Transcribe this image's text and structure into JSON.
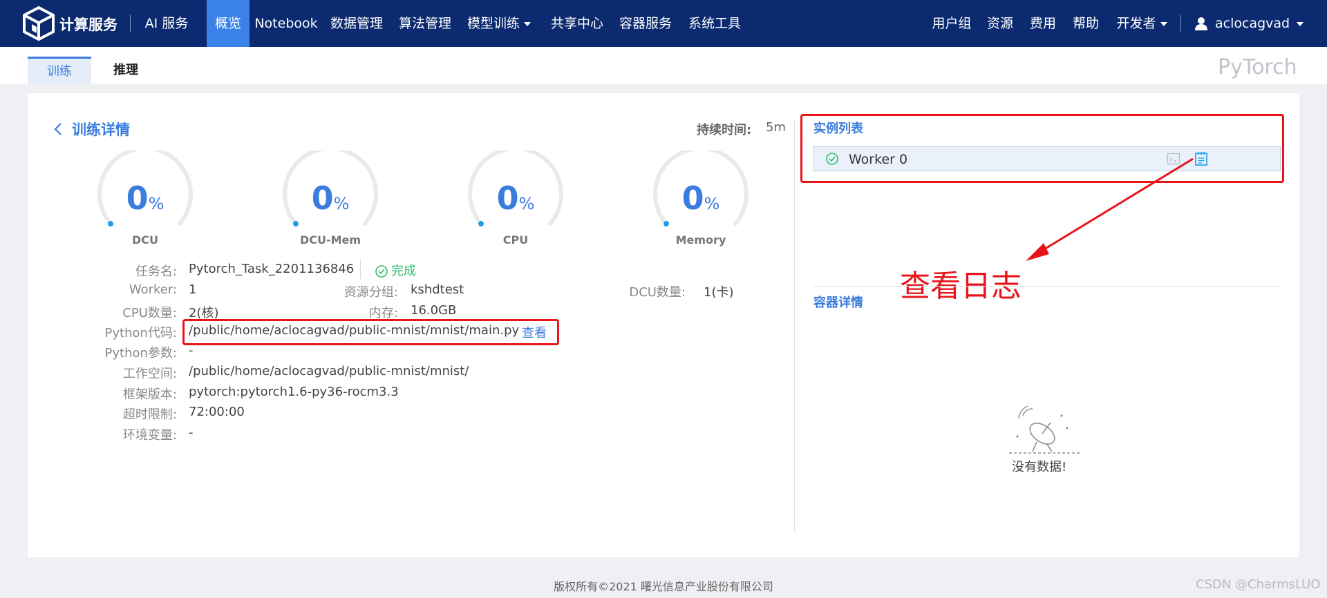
{
  "nav": {
    "brand": "计算服务",
    "ai_service": "AI 服务",
    "items": [
      "概览",
      "Notebook",
      "数据管理",
      "算法管理",
      "模型训练",
      "共享中心",
      "容器服务",
      "系统工具"
    ],
    "right_items": [
      "用户组",
      "资源",
      "费用",
      "帮助",
      "开发者"
    ],
    "username": "aclocagvad",
    "accent_color": "#3b82e8",
    "bar_color": "#0b2a6f"
  },
  "subtabs": [
    "训练",
    "推理"
  ],
  "framework_label": "PyTorch",
  "detail": {
    "back_label": "训练详情",
    "duration_label": "持续时间:",
    "duration_value": "5m",
    "gauges": [
      {
        "label": "DCU",
        "value": "0",
        "unit": "%"
      },
      {
        "label": "DCU-Mem",
        "value": "0",
        "unit": "%"
      },
      {
        "label": "CPU",
        "value": "0",
        "unit": "%"
      },
      {
        "label": "Memory",
        "value": "0",
        "unit": "%"
      }
    ],
    "task_name_label": "任务名:",
    "task_name": "Pytorch_Task_2201136846",
    "status": "完成",
    "worker_label": "Worker:",
    "worker_value": "1",
    "resource_group_label": "资源分组:",
    "resource_group_value": "kshdtest",
    "dcu_count_label": "DCU数量:",
    "dcu_count_value": "1(卡)",
    "cpu_count_label": "CPU数量:",
    "cpu_count_value": "2(核)",
    "memory_label": "内存:",
    "memory_value": "16.0GB",
    "python_code_label": "Python代码:",
    "python_code_value": "/public/home/aclocagvad/public-mnist/mnist/main.py",
    "view_link": "查看",
    "python_params_label": "Python参数:",
    "python_params_value": "-",
    "workspace_label": "工作空间:",
    "workspace_value": "/public/home/aclocagvad/public-mnist/mnist/",
    "framework_version_label": "框架版本:",
    "framework_version_value": "pytorch:pytorch1.6-py36-rocm3.3",
    "timeout_label": "超时限制:",
    "timeout_value": "72:00:00",
    "env_label": "环境变量:",
    "env_value": "-"
  },
  "instances": {
    "title": "实例列表",
    "workers": [
      {
        "name": "Worker 0"
      }
    ]
  },
  "annotation": "查看日志",
  "container": {
    "title": "容器详情",
    "empty_text": "没有数据!"
  },
  "footer": "版权所有©2021 曙光信息产业股份有限公司",
  "watermark": "CSDN @CharmsLUO"
}
